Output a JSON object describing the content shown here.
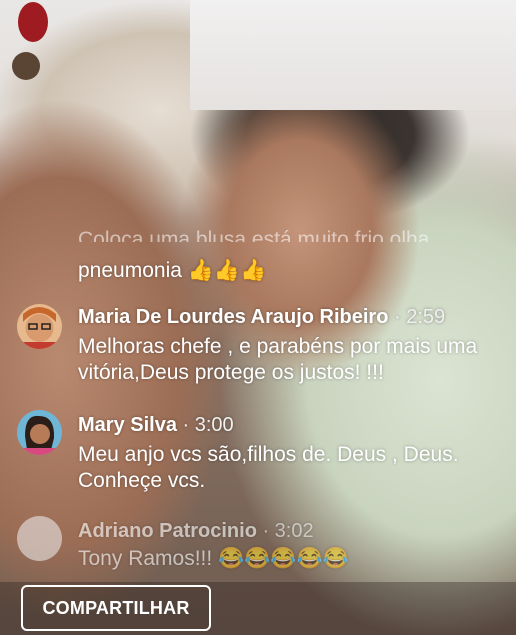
{
  "comments": {
    "partial": {
      "line1": "Coloca uma blusa está muito frio olha",
      "line2": "pneumonia 👍👍👍"
    },
    "items": [
      {
        "name": "Maria De Lourdes Araujo Ribeiro",
        "time": "· 2:59",
        "text": "Melhoras chefe , e parabéns por mais uma vitória,Deus protege os justos! !!!"
      },
      {
        "name": "Mary Silva",
        "time": "· 3:00",
        "text": "Meu anjo vcs são,filhos de. Deus , Deus. Conheçe vcs."
      },
      {
        "name": "Adriano Patrocinio",
        "time": "· 3:02",
        "text": "Tony Ramos!!! 😂😂😂😂😂"
      }
    ]
  },
  "share_button": {
    "label": "COMPARTILHAR"
  }
}
